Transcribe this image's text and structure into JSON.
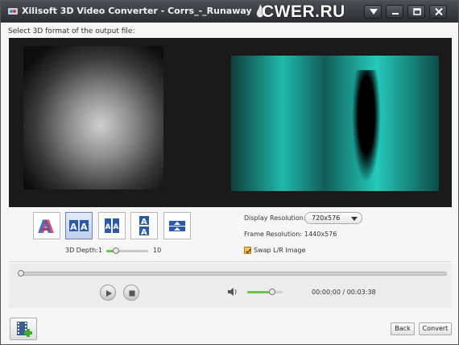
{
  "window": {
    "title": "Xilisoft 3D Video Converter - Corrs_-_Runaway",
    "watermark": "CWER.RU"
  },
  "instruction": "Select 3D format of the output file:",
  "modes": [
    {
      "name": "anaglyph",
      "selected": false
    },
    {
      "name": "side-by-side-full",
      "selected": true
    },
    {
      "name": "side-by-side-half",
      "selected": false
    },
    {
      "name": "top-bottom",
      "selected": false
    },
    {
      "name": "top-bottom-half",
      "selected": false
    }
  ],
  "depth": {
    "label": "3D Depth:",
    "min": "1",
    "max": "10",
    "value": 3
  },
  "settings": {
    "display_resolution_label": "Display Resolution:",
    "display_resolution_value": "720x576",
    "frame_resolution_label": "Frame Resolution:",
    "frame_resolution_value": "1440x576",
    "swap_label": "Swap L/R Image",
    "swap_checked": true
  },
  "player": {
    "seek_fraction": 0,
    "volume_fraction": 0.7,
    "time": "00:00:00 / 00:03:38"
  },
  "buttons": {
    "back": "Back",
    "convert": "Convert"
  },
  "colors": {
    "accent_green": "#6cc24a",
    "selected_blue": "#bdd0ec"
  }
}
